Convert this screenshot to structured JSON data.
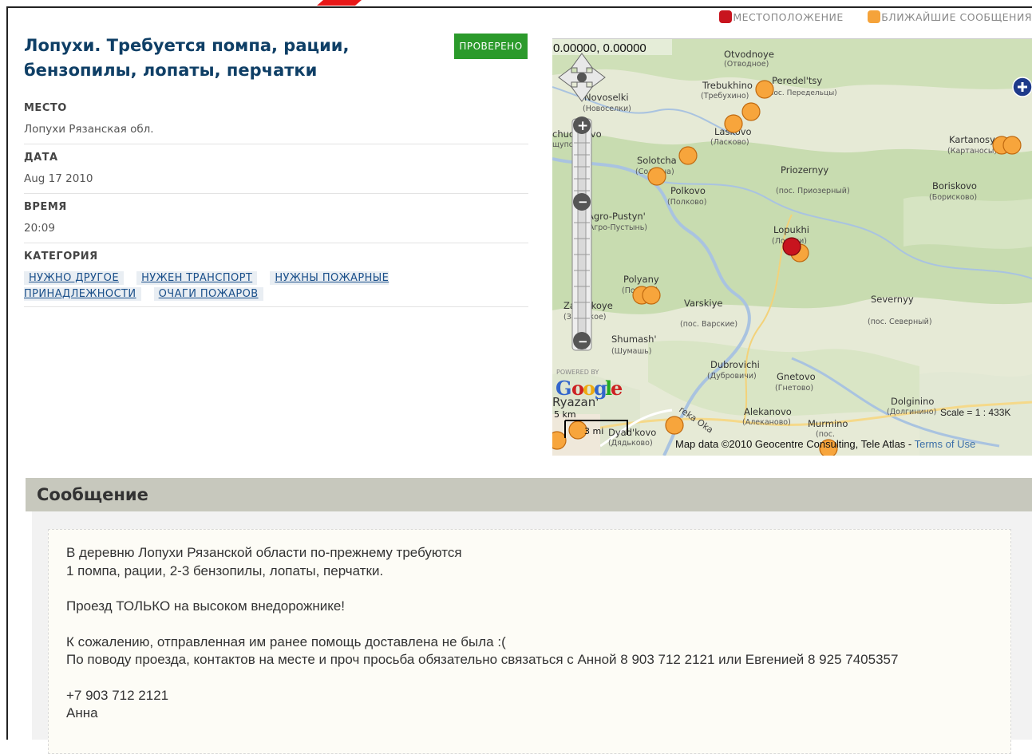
{
  "legend": {
    "location": "МЕСТОПОЛОЖЕНИЕ",
    "nearby": "БЛИЖАЙШИЕ СООБЩЕНИЯ",
    "location_color": "#c8141e",
    "nearby_color": "#f5a33a"
  },
  "report": {
    "title": "Лопухи. Требуется помпа, рации, бензопилы, лопаты, перчатки",
    "status": "ПРОВЕРЕНО",
    "fields": [
      {
        "label": "МЕСТО",
        "value": "Лопухи Рязанская обл."
      },
      {
        "label": "ДАТА",
        "value": "Aug 17 2010"
      },
      {
        "label": "ВРЕМЯ",
        "value": "20:09"
      }
    ],
    "category_label": "КАТЕГОРИЯ",
    "categories": [
      "НУЖНО ДРУГОЕ",
      "НУЖЕН ТРАНСПОРТ",
      "НУЖНЫ ПОЖАРНЫЕ ПРИНАДЛЕЖНОСТИ",
      "ОЧАГИ ПОЖАРОВ"
    ]
  },
  "map": {
    "coords": "0.00000, 0.00000",
    "attribution": "Map data ©2010 Geocentre Consulting, Tele Atlas - ",
    "terms": "Terms of Use",
    "scale": "Scale = 1 : 433K",
    "powered_by": "POWERED BY",
    "scalebar_km": "5 km",
    "scalebar_mi": "3 mi",
    "places": [
      {
        "name": "Otvodnoye",
        "ru": "(Отводное)"
      },
      {
        "name": "Trebukhino",
        "ru": "(Требухино)"
      },
      {
        "name": "Peredel'tsy",
        "ru": "(пос. Передельцы)"
      },
      {
        "name": "Novoselki",
        "ru": "(Новоселки)"
      },
      {
        "name": "Laskovo",
        "ru": "(Ласково)"
      },
      {
        "name": "Kartanosy",
        "ru": "(Картаносы)"
      },
      {
        "name": "Solotcha",
        "ru": "(Солотча)"
      },
      {
        "name": "Priozernyy",
        "ru": "(пос. Приозерный)"
      },
      {
        "name": "Polkovo",
        "ru": "(Полково)"
      },
      {
        "name": "Boriskovo",
        "ru": "(Борисково)"
      },
      {
        "name": "Agro-Pustyn'",
        "ru": "(Агро-Пустынь)"
      },
      {
        "name": "Lopukhi",
        "ru": "(Лопухи)"
      },
      {
        "name": "Polyany",
        "ru": "(Поляны)"
      },
      {
        "name": "Varskiye",
        "ru": "(пос. Варские)"
      },
      {
        "name": "Severnyy",
        "ru": "(пос. Северный)"
      },
      {
        "name": "Zaokskoye",
        "ru": "(Заокское)"
      },
      {
        "name": "Shumash'",
        "ru": "(Шумашь)"
      },
      {
        "name": "Dubrovichi",
        "ru": "(Дубровичи)"
      },
      {
        "name": "Gnetovo",
        "ru": "(Гнетово)"
      },
      {
        "name": "Ryazan'",
        "ru": ""
      },
      {
        "name": "Dolginino",
        "ru": "(Долгинино)"
      },
      {
        "name": "Alekanovo",
        "ru": "(Алеканово)"
      },
      {
        "name": "Murmino",
        "ru": "(пос."
      },
      {
        "name": "Dyad'kovo",
        "ru": "(Дядьково)"
      },
      {
        "name": "reka Oka",
        "ru": ""
      },
      {
        "name": "chuchkovo",
        "ru": "щупово"
      }
    ]
  },
  "message": {
    "heading": "Сообщение",
    "paragraphs": [
      [
        "В деревню Лопухи Рязанской области по-прежнему требуются",
        "1 помпа, рации, 2-3 бензопилы, лопаты, перчатки."
      ],
      [
        "Проезд ТОЛЬКО на высоком внедорожнике!"
      ],
      [
        "К сожалению, отправленная им ранее помощь доставлена не была :(",
        "По поводу проезда, контактов на месте и проч просьба обязательно связаться с Анной 8 903 712 2121 или Евгенией 8 925 7405357"
      ],
      [
        "+7 903 712 2121",
        "Анна"
      ]
    ]
  }
}
